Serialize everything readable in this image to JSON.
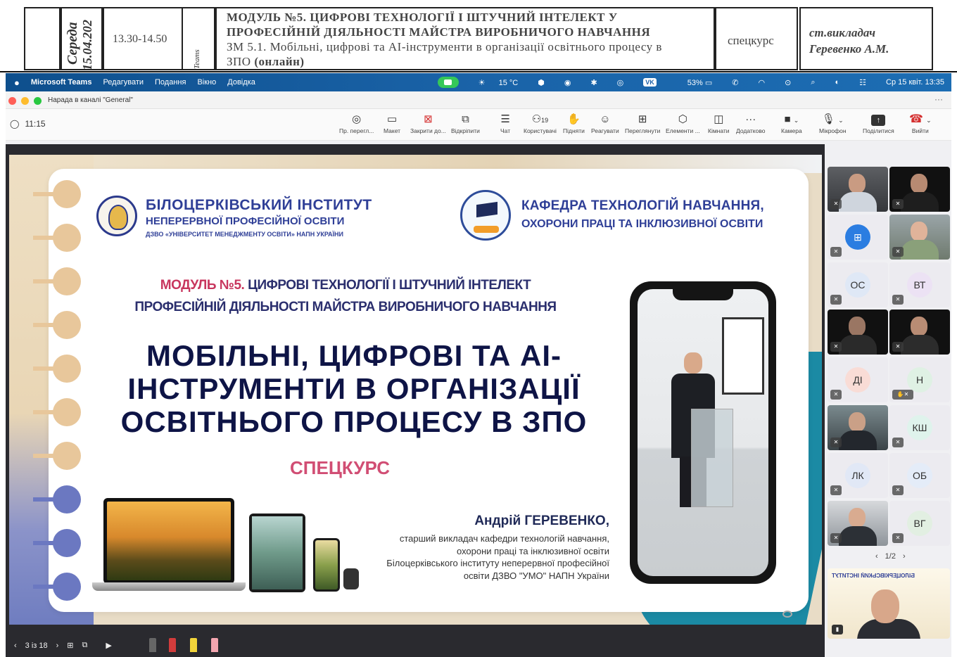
{
  "schedule": {
    "day": "Середа",
    "date": "15.04.202",
    "time": "13.30-14.50",
    "platform": "Teams",
    "module_line1": "МОДУЛЬ №5. ЦИФРОВІ ТЕХНОЛОГІЇ І ШТУЧНИЙ ІНТЕЛЕКТ У",
    "module_line2": "ПРОФЕСІЙНІЙ ДІЯЛЬНОСТІ МАЙСТРА ВИРОБНИЧОГО НАВЧАННЯ",
    "module_line3": "ЗМ 5.1. Мобільні, цифрові та АІ-інструменти в організації освітнього процесу в",
    "module_line4": "ЗПО",
    "module_online": "(онлайн)",
    "type": "спецкурс",
    "teacher_line1": "ст.викладач",
    "teacher_line2": "Геревенко А.М."
  },
  "menubar": {
    "app": "Microsoft Teams",
    "items": [
      "Редагувати",
      "Подання",
      "Вікно",
      "Довідка"
    ],
    "weather": "15 °C",
    "vk": "VK",
    "battery": "53%",
    "datetime": "Ср 15 квіт.  13:35"
  },
  "window": {
    "title": "Нарада в каналі \"General\"",
    "more": "···"
  },
  "toolbar": {
    "timer": "11:15",
    "buttons": [
      {
        "label": "Пр. перегл...",
        "icon": "eye-icon",
        "glyph": "◎"
      },
      {
        "label": "Макет",
        "icon": "layout-icon",
        "glyph": "▭"
      },
      {
        "label": "Закрити до...",
        "icon": "close-icon",
        "glyph": "⊠"
      },
      {
        "label": "Відкріпити",
        "icon": "popout-icon",
        "glyph": "⧉"
      },
      {
        "label": "Чат",
        "icon": "chat-icon",
        "glyph": "☰"
      },
      {
        "label": "Користувачі",
        "icon": "people-icon",
        "glyph": "⚇",
        "count": "19"
      },
      {
        "label": "Підняти",
        "icon": "raise-hand-icon",
        "glyph": "✋"
      },
      {
        "label": "Реагувати",
        "icon": "react-icon",
        "glyph": "☺"
      },
      {
        "label": "Переглянути",
        "icon": "view-icon",
        "glyph": "⊞"
      },
      {
        "label": "Елементи ...",
        "icon": "apps-icon",
        "glyph": "⬡"
      },
      {
        "label": "Кімнати",
        "icon": "rooms-icon",
        "glyph": "◫"
      },
      {
        "label": "Додатково",
        "icon": "more-icon",
        "glyph": "···"
      },
      {
        "label": "Камера",
        "icon": "camera-icon",
        "glyph": "■"
      },
      {
        "label": "Мікрофон",
        "icon": "microphone-icon",
        "glyph": "🎙"
      },
      {
        "label": "Поділитися",
        "icon": "share-icon",
        "glyph": "↑"
      },
      {
        "label": "Вийти",
        "icon": "leave-icon",
        "glyph": "☎"
      }
    ]
  },
  "slide": {
    "inst_name": "БІЛОЦЕРКІВСЬКИЙ ІНСТИТУТ",
    "inst_sub": "НЕПЕРЕРВНОЇ ПРОФЕСІЙНОЇ ОСВІТИ",
    "inst_small": "ДЗВО «УНІВЕРСИТЕТ МЕНЕДЖМЕНТУ ОСВІТИ» НАПН УКРАЇНИ",
    "dept_line1": "КАФЕДРА ТЕХНОЛОГІЙ НАВЧАННЯ,",
    "dept_line2": "ОХОРОНИ ПРАЦІ ТА ІНКЛЮЗИВНОЇ ОСВІТИ",
    "module_num": "МОДУЛЬ №5.",
    "module_rest": " ЦИФРОВІ ТЕХНОЛОГІЇ І ШТУЧНИЙ ІНТЕЛЕКТ",
    "module_line2": "ПРОФЕСІЙНІЙ ДІЯЛЬНОСТІ МАЙСТРА ВИРОБНИЧОГО НАВЧАННЯ",
    "title_line1": "МОБІЛЬНІ, ЦИФРОВІ ТА АІ-",
    "title_line2": "ІНСТРУМЕНТИ В ОРГАНІЗАЦІЇ",
    "title_line3": "ОСВІТНЬОГО ПРОЦЕСУ В ЗПО",
    "spec": "СПЕЦКУРС",
    "author_name": "Андрій ГЕРЕВЕНКО,",
    "author_d1": "старший викладач кафедри технологій навчання,",
    "author_d2": "охорони праці та інклюзивної освіти",
    "author_d3": "Білоцерківського інституту неперервної професійної",
    "author_d4": "освіти ДЗВО \"УМО\" НАПН України"
  },
  "presenter": {
    "page": "3 із 18"
  },
  "participants": [
    {
      "initials": "ОС",
      "color": "#dfe8f6"
    },
    {
      "initials": "ВТ",
      "color": "#ece2f4"
    },
    {
      "initials": "ДІ",
      "color": "#f9dcd6"
    },
    {
      "initials": "Н",
      "color": "#dff1e4"
    },
    {
      "initials": "КШ",
      "color": "#dff3ec"
    },
    {
      "initials": "ЛК",
      "color": "#e1e8f6"
    },
    {
      "initials": "ОБ",
      "color": "#e4ecf8"
    },
    {
      "initials": "ВГ",
      "color": "#e2efe2"
    }
  ],
  "pager": "1/2",
  "selfview_text": "БІЛОЦЕРКІВСЬКИЙ ІНСТИТУТ"
}
